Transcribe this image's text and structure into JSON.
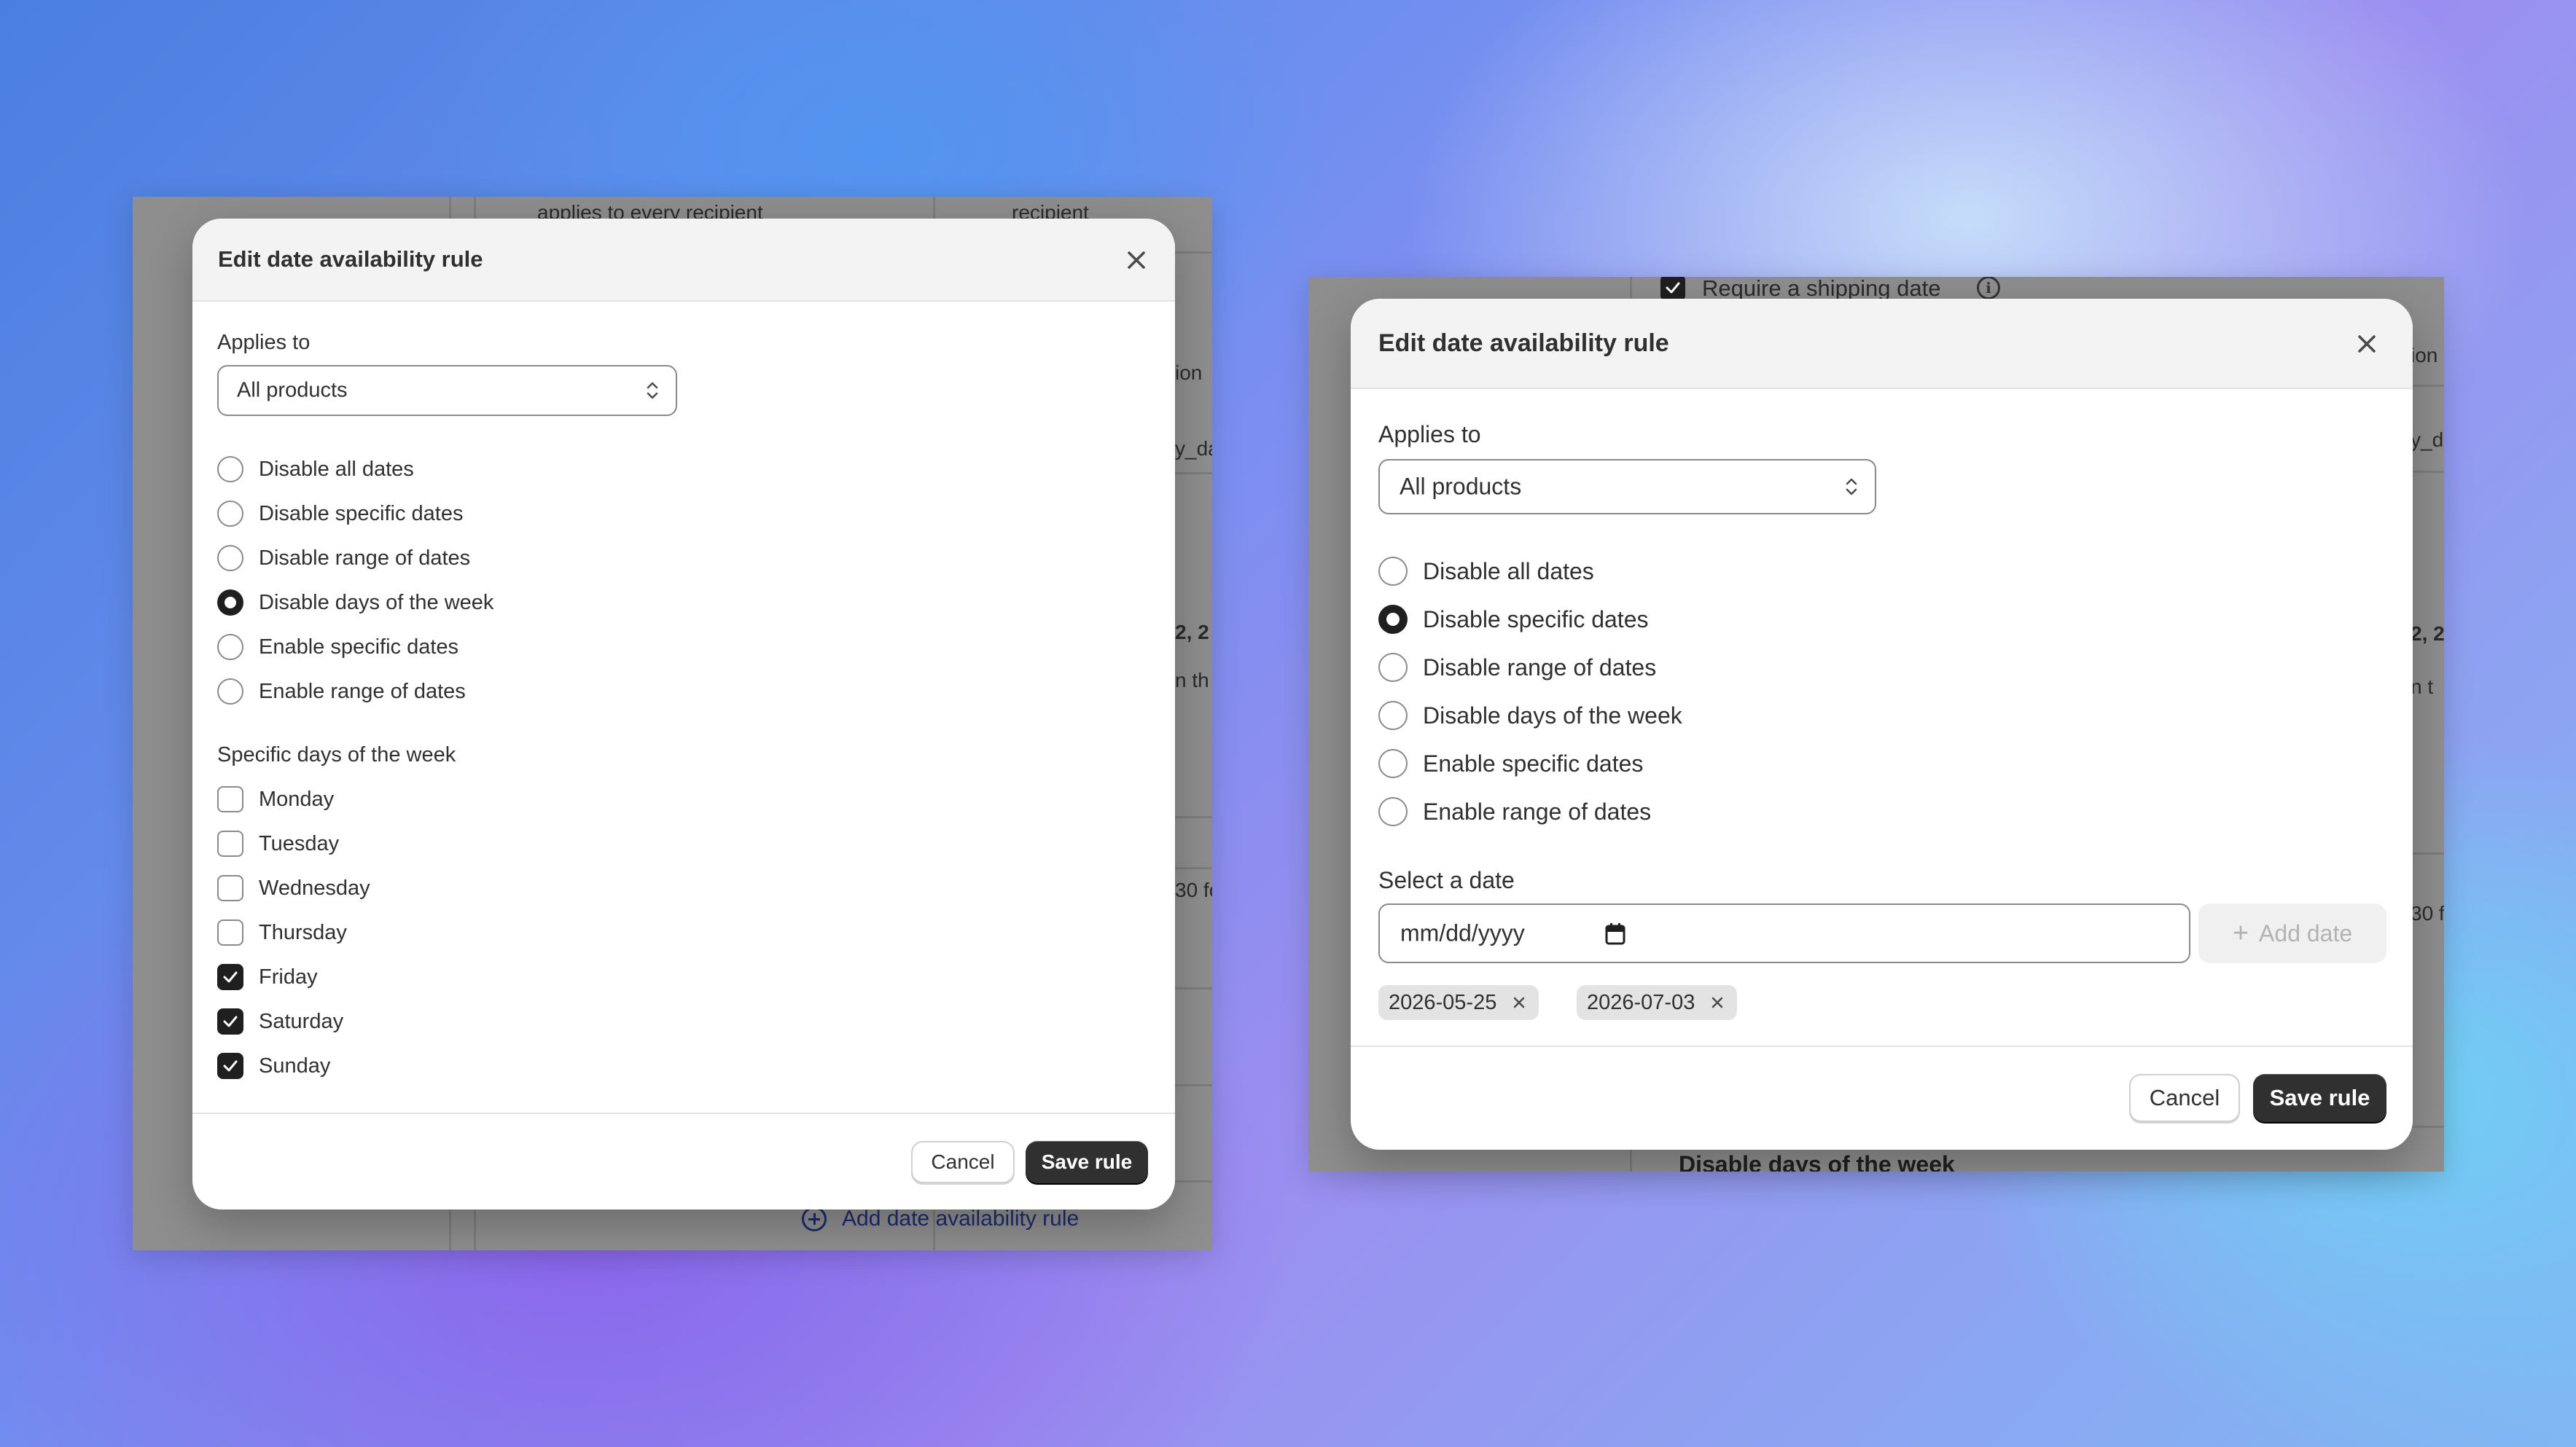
{
  "left_window": {
    "background": {
      "header_col1": "applies to every recipient",
      "header_col2": "recipient",
      "frag_ion": "ion",
      "frag_yda": "y_da",
      "frag_22": "2, 2",
      "frag_nth": "n th",
      "frag_30f": "30 fo",
      "add_rule_link": "Add date availability rule"
    },
    "modal": {
      "title": "Edit date availability rule",
      "applies_to_label": "Applies to",
      "applies_to_value": "All products",
      "options": [
        {
          "label": "Disable all dates",
          "checked": false
        },
        {
          "label": "Disable specific dates",
          "checked": false
        },
        {
          "label": "Disable range of dates",
          "checked": false
        },
        {
          "label": "Disable days of the week",
          "checked": true
        },
        {
          "label": "Enable specific dates",
          "checked": false
        },
        {
          "label": "Enable range of dates",
          "checked": false
        }
      ],
      "days_label": "Specific days of the week",
      "days": [
        {
          "label": "Monday",
          "checked": false
        },
        {
          "label": "Tuesday",
          "checked": false
        },
        {
          "label": "Wednesday",
          "checked": false
        },
        {
          "label": "Thursday",
          "checked": false
        },
        {
          "label": "Friday",
          "checked": true
        },
        {
          "label": "Saturday",
          "checked": true
        },
        {
          "label": "Sunday",
          "checked": true
        }
      ],
      "cancel_label": "Cancel",
      "save_label": "Save rule"
    }
  },
  "right_window": {
    "background": {
      "require_shipping_label": "Require a shipping date",
      "frag_ion": "ion",
      "frag_yd": "y_d",
      "frag_22": "2, 2",
      "frag_nt": "n t",
      "frag_30": "30 f",
      "days_of_week_heading": "Disable days of the week"
    },
    "modal": {
      "title": "Edit date availability rule",
      "applies_to_label": "Applies to",
      "applies_to_value": "All products",
      "options": [
        {
          "label": "Disable all dates",
          "checked": false
        },
        {
          "label": "Disable specific dates",
          "checked": true
        },
        {
          "label": "Disable range of dates",
          "checked": false
        },
        {
          "label": "Disable days of the week",
          "checked": false
        },
        {
          "label": "Enable specific dates",
          "checked": false
        },
        {
          "label": "Enable range of dates",
          "checked": false
        }
      ],
      "select_date_label": "Select a date",
      "date_placeholder": "mm/dd/yyyy",
      "add_date_label": "Add date",
      "selected_dates": [
        "2026-05-25",
        "2026-07-03"
      ],
      "cancel_label": "Cancel",
      "save_label": "Save rule"
    }
  },
  "colors": {
    "primary_button": "#303030",
    "modal_header": "#f3f3f3",
    "overlay": "#8e8e8e"
  }
}
